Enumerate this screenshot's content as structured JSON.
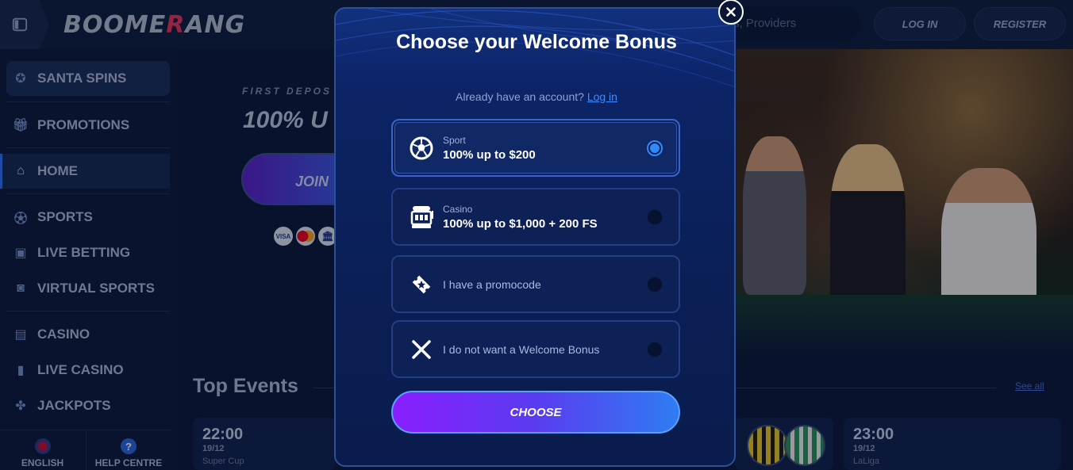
{
  "header": {
    "logo_prefix": "BOOME",
    "logo_r": "R",
    "logo_suffix": "ANG",
    "search_placeholder": "s, Providers",
    "login_label": "LOG IN",
    "register_label": "REGISTER"
  },
  "sidebar": {
    "items": [
      {
        "label": "SANTA SPINS",
        "icon": "santa-icon"
      },
      {
        "label": "PROMOTIONS",
        "icon": "gift-icon"
      },
      {
        "label": "HOME",
        "icon": "home-icon"
      },
      {
        "label": "SPORTS",
        "icon": "football-icon"
      },
      {
        "label": "LIVE BETTING",
        "icon": "live-icon"
      },
      {
        "label": "VIRTUAL SPORTS",
        "icon": "virtual-icon"
      },
      {
        "label": "CASINO",
        "icon": "slot-machine-icon"
      },
      {
        "label": "LIVE CASINO",
        "icon": "card-icon"
      },
      {
        "label": "JACKPOTS",
        "icon": "clover-icon"
      }
    ],
    "bottom": [
      {
        "label": "ENGLISH",
        "icon": "flag-icon"
      },
      {
        "label": "HELP CENTRE",
        "icon": "help-icon"
      }
    ]
  },
  "hero": {
    "label": "FIRST DEPOS",
    "title": "100% U",
    "join_label": "JOIN",
    "payment_icons": [
      "VISA",
      "MC",
      "BANK"
    ]
  },
  "events": {
    "title": "Top Events",
    "see_all": "See all",
    "cards": [
      {
        "time": "22:00",
        "date": "19/12",
        "league": "Super Cup"
      },
      {
        "time": "23:00",
        "date": "19/12",
        "league": "LaLiga"
      }
    ]
  },
  "modal": {
    "title": "Choose your Welcome Bonus",
    "account_prompt": "Already have an account?",
    "login_link": "Log in",
    "options": [
      {
        "category": "Sport",
        "offer": "100% up to $200",
        "icon": "football-icon",
        "selected": true
      },
      {
        "category": "Casino",
        "offer": "100% up to $1,000 + 200 FS",
        "icon": "slot-machine-icon",
        "selected": false
      },
      {
        "label": "I have a promocode",
        "icon": "ticket-icon",
        "selected": false
      },
      {
        "label": "I do not want a Welcome Bonus",
        "icon": "cross-icon",
        "selected": false
      }
    ],
    "choose_label": "CHOOSE"
  },
  "colors": {
    "accent_blue": "#2d8bff",
    "button_gradient_start": "#8a1eff",
    "button_gradient_end": "#2f7cf2",
    "logo_r": "#e5325b"
  }
}
